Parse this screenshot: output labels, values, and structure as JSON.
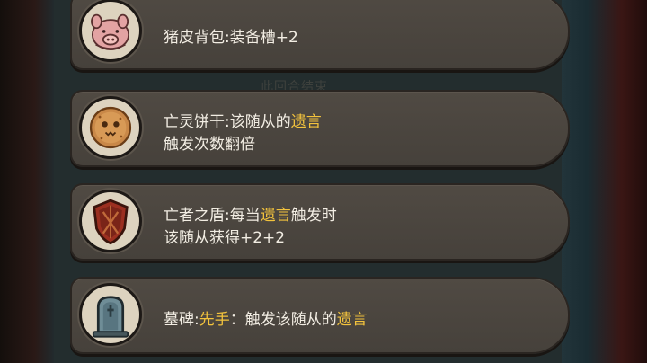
{
  "background_faint_text": "此回合结束",
  "colors": {
    "highlight": "#f3c33d",
    "text": "#f2ede3",
    "card": "#4b463f"
  },
  "items": [
    {
      "icon": "pig-backpack-icon",
      "line1": {
        "pre": "猪皮背包:装备槽+2",
        "kw": "",
        "post": ""
      },
      "line2": {
        "pre": "",
        "kw": "",
        "post": ""
      }
    },
    {
      "icon": "undead-cookie-icon",
      "line1": {
        "pre": "亡灵饼干:该随从的",
        "kw": "遗言",
        "post": ""
      },
      "line2": {
        "pre": "触发次数翻倍",
        "kw": "",
        "post": ""
      }
    },
    {
      "icon": "shield-icon",
      "line1": {
        "pre": "亡者之盾:每当",
        "kw": "遗言",
        "post": "触发时"
      },
      "line2": {
        "pre": "该随从获得+2+2",
        "kw": "",
        "post": ""
      }
    },
    {
      "icon": "tombstone-icon",
      "line1": {
        "pre": "墓碑:",
        "kw": "先手",
        "post": "：触发该随从的"
      },
      "line1_kw2": "遗言",
      "line2": {
        "pre": "",
        "kw": "",
        "post": ""
      }
    }
  ]
}
